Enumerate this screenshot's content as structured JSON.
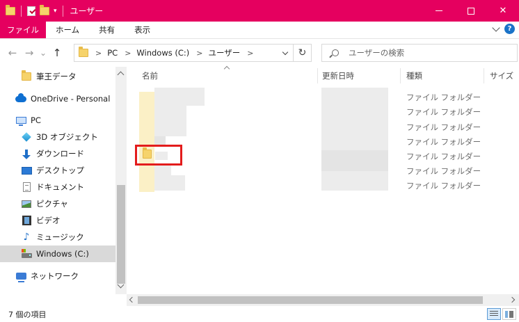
{
  "window": {
    "title": "ユーザー",
    "min_symbol": "—",
    "max_symbol": "☐",
    "close_symbol": "✕"
  },
  "ribbon": {
    "tabs": [
      "ファイル",
      "ホーム",
      "共有",
      "表示"
    ]
  },
  "nav": {
    "back_symbol": "←",
    "forward_symbol": "→",
    "recent_symbol": "⌄",
    "up_symbol": "↑",
    "refresh_symbol": "↻",
    "breadcrumbs": [
      "PC",
      "Windows (C:)",
      "ユーザー"
    ],
    "search_placeholder": "ユーザーの検索"
  },
  "sidebar": {
    "items": [
      {
        "label": "筆王データ",
        "icon": "folder-icon"
      },
      {
        "label": "OneDrive - Personal",
        "icon": "onedrive-icon"
      },
      {
        "label": "PC",
        "icon": "pc-icon"
      },
      {
        "label": "3D オブジェクト",
        "icon": "3d-objects-icon"
      },
      {
        "label": "ダウンロード",
        "icon": "download-icon"
      },
      {
        "label": "デスクトップ",
        "icon": "desktop-icon"
      },
      {
        "label": "ドキュメント",
        "icon": "document-icon"
      },
      {
        "label": "ピクチャ",
        "icon": "picture-icon"
      },
      {
        "label": "ビデオ",
        "icon": "video-icon"
      },
      {
        "label": "ミュージック",
        "icon": "music-icon"
      },
      {
        "label": "Windows (C:)",
        "icon": "drive-icon"
      },
      {
        "label": "ネットワーク",
        "icon": "network-icon"
      }
    ]
  },
  "columns": {
    "name": "名前",
    "date": "更新日時",
    "type": "種類",
    "size": "サイズ"
  },
  "rows": [
    {
      "type": "ファイル フォルダー"
    },
    {
      "type": "ファイル フォルダー"
    },
    {
      "type": "ファイル フォルダー"
    },
    {
      "type": "ファイル フォルダー"
    },
    {
      "type": "ファイル フォルダー"
    },
    {
      "type": "ファイル フォルダー"
    },
    {
      "type": "ファイル フォルダー"
    }
  ],
  "status": {
    "item_count": "7 個の項目"
  },
  "colors": {
    "accent": "#e5005f",
    "highlight": "#e31c1c"
  }
}
